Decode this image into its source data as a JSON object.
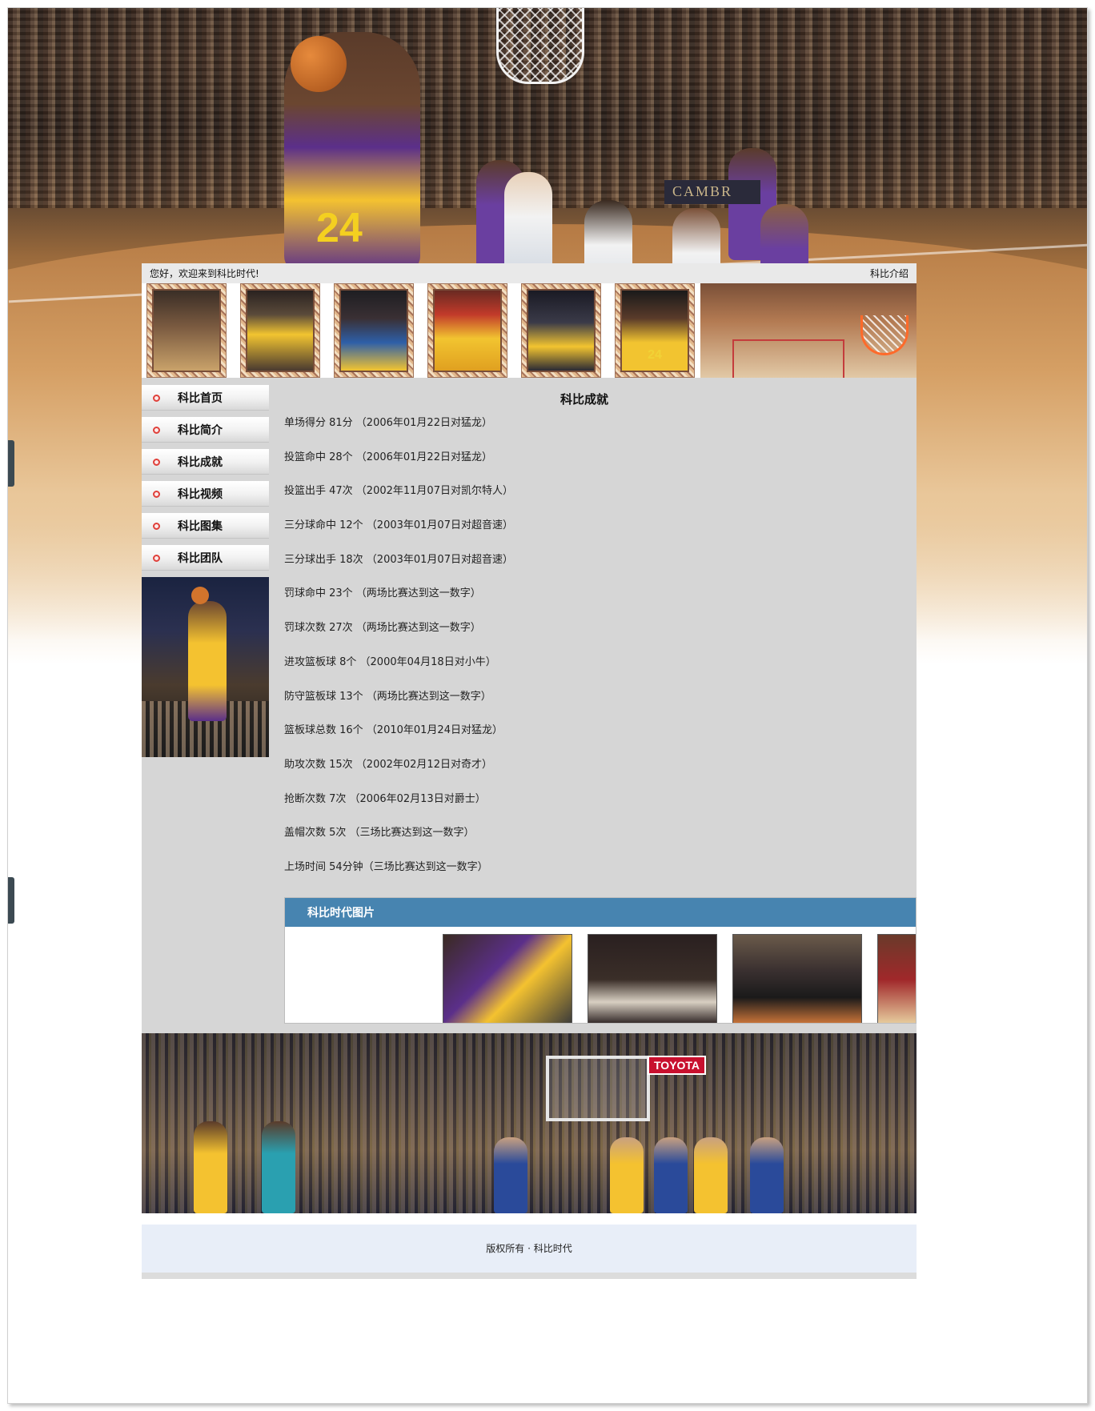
{
  "header": {
    "welcome_text": "您好，欢迎来到科比时代!",
    "intro_link": "科比介绍"
  },
  "hero": {
    "jersey_number": "24",
    "scoreboard_text": "CAMBR"
  },
  "thumbnails": [
    {
      "icon": "photo-kobe-floor"
    },
    {
      "icon": "photo-kobe-standing"
    },
    {
      "icon": "photo-kobe-31"
    },
    {
      "icon": "photo-kobe-hug"
    },
    {
      "icon": "photo-kobe-bench"
    },
    {
      "icon": "photo-kobe-24",
      "number": "24"
    }
  ],
  "sidebar": {
    "items": [
      {
        "label": "科比首页"
      },
      {
        "label": "科比简介"
      },
      {
        "label": "科比成就"
      },
      {
        "label": "科比视频"
      },
      {
        "label": "科比图集"
      },
      {
        "label": "科比团队"
      }
    ]
  },
  "main": {
    "title": "科比成就",
    "achievements": [
      "单场得分 81分 （2006年01月22日对猛龙）",
      "投篮命中 28个 （2006年01月22日对猛龙）",
      "投篮出手 47次 （2002年11月07日对凯尔特人）",
      "三分球命中 12个 （2003年01月07日对超音速）",
      "三分球出手 18次 （2003年01月07日对超音速）",
      "罚球命中 23个 （两场比赛达到这一数字）",
      "罚球次数 27次 （两场比赛达到这一数字）",
      "进攻篮板球 8个 （2000年04月18日对小牛）",
      "防守篮板球 13个 （两场比赛达到这一数字）",
      "篮板球总数 16个 （2010年01月24日对猛龙）",
      "助攻次数 15次 （2002年02月12日对奇才）",
      "抢断次数 7次 （2006年02月13日对爵士）",
      "盖帽次数 5次 （三场比赛达到这一数字）",
      "上场时间 54分钟（三场比赛达到这一数字）"
    ]
  },
  "gallery": {
    "title": "科比时代图片"
  },
  "bottom_banner": {
    "sign_text": "TOYOTA"
  },
  "footer": {
    "copyright": "版权所有 · 科比时代"
  },
  "colors": {
    "gallery_header": "#4784b0",
    "content_bg": "#d6d6d6",
    "menu_dot": "#e0403a",
    "footer_bg": "#e8eef8"
  }
}
